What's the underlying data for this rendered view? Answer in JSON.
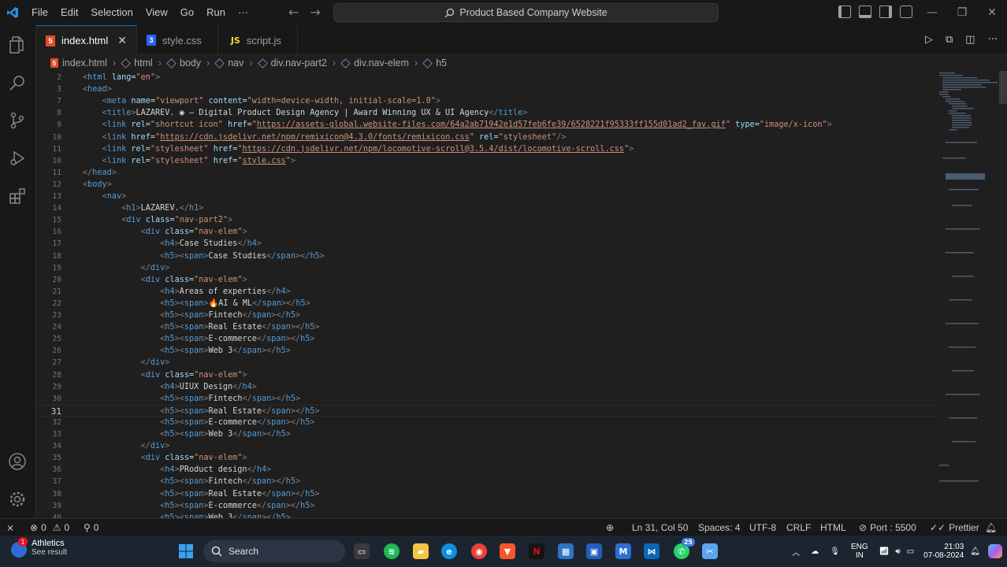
{
  "menu": [
    "File",
    "Edit",
    "Selection",
    "View",
    "Go",
    "Run",
    "···"
  ],
  "command_center": "Product Based Company Website",
  "tabs": [
    {
      "label": "index.html",
      "icon": "html-icon",
      "active": true
    },
    {
      "label": "style.css",
      "icon": "css-icon",
      "active": false
    },
    {
      "label": "script.js",
      "icon": "js-icon",
      "active": false
    }
  ],
  "breadcrumb": [
    "index.html",
    "html",
    "body",
    "nav",
    "div.nav-part2",
    "div.nav-elem",
    "h5"
  ],
  "editor": {
    "current_line": 31,
    "lines": [
      {
        "n": "2",
        "code": "<html lang=\"en\">"
      },
      {
        "n": "3",
        "code": "<head>"
      },
      {
        "n": "7",
        "code": "    <meta name=\"viewport\" content=\"width=device-width, initial-scale=1.0\">"
      },
      {
        "n": "8",
        "code": "    <title>LAZAREV. ◉ — Digital Product Design Agency | Award Winning UX & UI Agency</title>"
      },
      {
        "n": "9",
        "code": "    <link rel=\"shortcut icon\" href=\"https://assets-global.website-files.com/64a2ab71942e1d57feb6fe39/6528221f95333ff155d01ad2_fav.gif\" type=\"image/x-icon\">"
      },
      {
        "n": "10",
        "code": "    <link href=\"https://cdn.jsdelivr.net/npm/remixicon@4.3.0/fonts/remixicon.css\" rel=\"stylesheet\"/>"
      },
      {
        "n": "11",
        "code": "    <link rel=\"stylesheet\" href=\"https://cdn.jsdelivr.net/npm/locomotive-scroll@3.5.4/dist/locomotive-scroll.css\">"
      },
      {
        "n": "10",
        "code": "    <link rel=\"stylesheet\" href=\"style.css\">"
      },
      {
        "n": "11",
        "code": "</head>"
      },
      {
        "n": "12",
        "code": "<body>"
      },
      {
        "n": "13",
        "code": "    <nav>"
      },
      {
        "n": "14",
        "code": "        <h1>LAZAREV.</h1>"
      },
      {
        "n": "15",
        "code": "        <div class=\"nav-part2\">"
      },
      {
        "n": "16",
        "code": "            <div class=\"nav-elem\">"
      },
      {
        "n": "17",
        "code": "                <h4>Case Studies</h4>"
      },
      {
        "n": "18",
        "code": "                <h5><span>Case Studies</span></h5>"
      },
      {
        "n": "19",
        "code": "            </div>"
      },
      {
        "n": "20",
        "code": "            <div class=\"nav-elem\">"
      },
      {
        "n": "21",
        "code": "                <h4>Areas of experties</h4>"
      },
      {
        "n": "22",
        "code": "                <h5><span>🔥AI & ML</span></h5>"
      },
      {
        "n": "23",
        "code": "                <h5><span>Fintech</span></h5>"
      },
      {
        "n": "24",
        "code": "                <h5><span>Real Estate</span></h5>"
      },
      {
        "n": "25",
        "code": "                <h5><span>E-commerce</span></h5>"
      },
      {
        "n": "26",
        "code": "                <h5><span>Web 3</span></h5>"
      },
      {
        "n": "27",
        "code": "            </div>"
      },
      {
        "n": "28",
        "code": "            <div class=\"nav-elem\">"
      },
      {
        "n": "29",
        "code": "                <h4>UIUX Design</h4>"
      },
      {
        "n": "30",
        "code": "                <h5><span>Fintech</span></h5>"
      },
      {
        "n": "31",
        "code": "                <h5><span>Real Estate</span></h5>"
      },
      {
        "n": "32",
        "code": "                <h5><span>E-commerce</span></h5>"
      },
      {
        "n": "33",
        "code": "                <h5><span>Web 3</span></h5>"
      },
      {
        "n": "34",
        "code": "            </div>"
      },
      {
        "n": "35",
        "code": "            <div class=\"nav-elem\">"
      },
      {
        "n": "36",
        "code": "                <h4>PRoduct design</h4>"
      },
      {
        "n": "37",
        "code": "                <h5><span>Fintech</span></h5>"
      },
      {
        "n": "38",
        "code": "                <h5><span>Real Estate</span></h5>"
      },
      {
        "n": "39",
        "code": "                <h5><span>E-commerce</span></h5>"
      },
      {
        "n": "40",
        "code": "                <h5><span>Web 3</span></h5>"
      }
    ]
  },
  "statusbar": {
    "errors": "0",
    "warnings": "0",
    "ports": "0",
    "position": "Ln 31, Col 50",
    "spaces": "Spaces: 4",
    "encoding": "UTF-8",
    "eol": "CRLF",
    "language": "HTML",
    "port": "Port : 5500",
    "prettier": "Prettier"
  },
  "taskbar": {
    "notification_title": "Athletics",
    "notification_sub": "See result",
    "search_placeholder": "Search",
    "lang_1": "ENG",
    "lang_2": "IN",
    "time": "21:03",
    "date": "07-08-2024",
    "badge": "25"
  },
  "colors": {
    "accent": "#0078d4",
    "html_tag": "#569cd6",
    "attr": "#9cdcfe",
    "string": "#ce9178"
  }
}
